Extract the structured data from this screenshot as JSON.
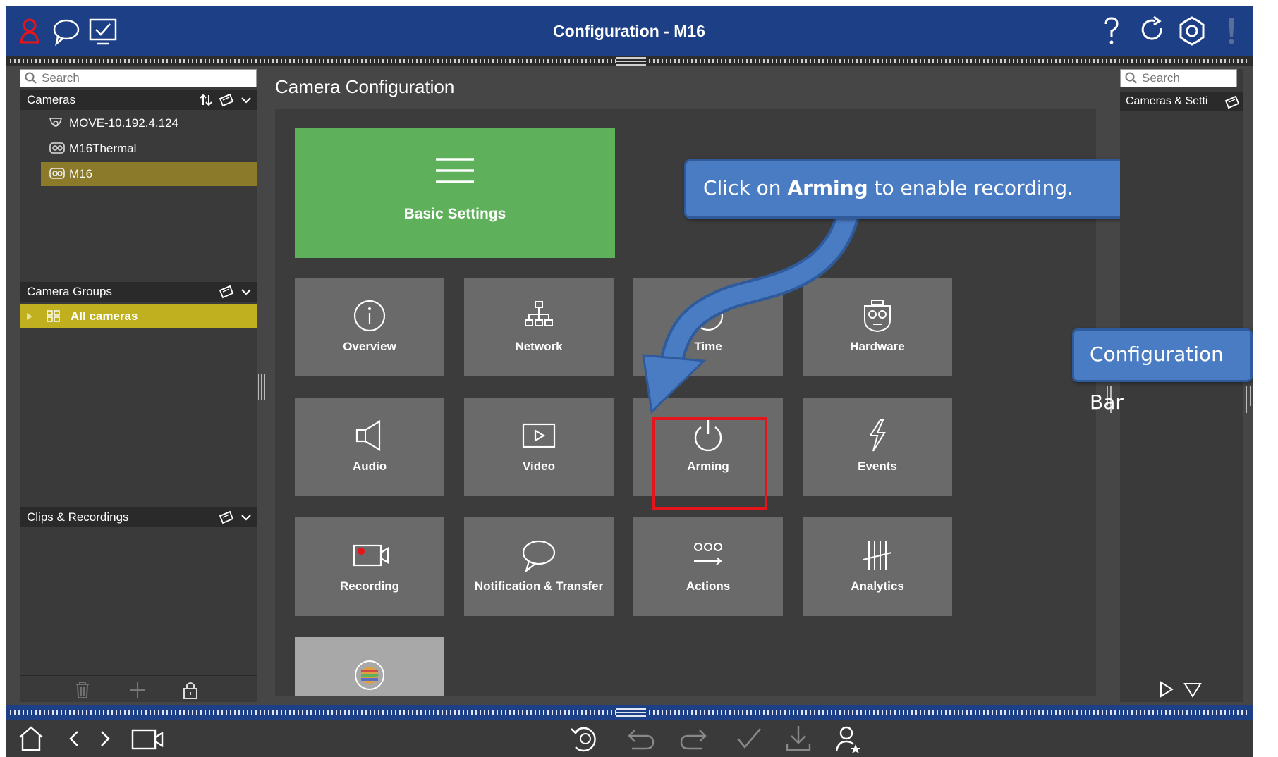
{
  "window": {
    "title": "Configuration - M16"
  },
  "left_panel": {
    "search_placeholder": "Search",
    "cameras_header": "Cameras",
    "cameras": [
      {
        "name": "MOVE-10.192.4.124",
        "selected": false
      },
      {
        "name": "M16Thermal",
        "selected": false
      },
      {
        "name": "M16",
        "selected": true
      }
    ],
    "groups_header": "Camera Groups",
    "group_selected": "All cameras",
    "clips_header": "Clips & Recordings"
  },
  "main": {
    "heading": "Camera Configuration",
    "basic_settings_label": "Basic Settings",
    "tiles": [
      {
        "label": "Overview",
        "icon": "info-icon"
      },
      {
        "label": "Network",
        "icon": "network-icon"
      },
      {
        "label": "Time",
        "icon": "clock-icon"
      },
      {
        "label": "Hardware",
        "icon": "hardware-icon"
      },
      {
        "label": "Audio",
        "icon": "speaker-icon"
      },
      {
        "label": "Video",
        "icon": "video-play-icon"
      },
      {
        "label": "Arming",
        "icon": "power-icon"
      },
      {
        "label": "Events",
        "icon": "lightning-icon"
      },
      {
        "label": "Recording",
        "icon": "recording-camera-icon"
      },
      {
        "label": "Notification & Transfer",
        "icon": "speech-bubble-icon"
      },
      {
        "label": "Actions",
        "icon": "actions-icon"
      },
      {
        "label": "Analytics",
        "icon": "tally-icon"
      }
    ]
  },
  "right_panel": {
    "search_placeholder": "Search",
    "section_label": "Cameras & Setti"
  },
  "annotations": {
    "arming_callout_prefix": "Click on ",
    "arming_callout_bold": "Arming",
    "arming_callout_suffix": " to enable recording.",
    "config_bar_callout": "Configuration Bar"
  },
  "colors": {
    "titlebar": "#1c3f86",
    "basic_settings": "#5fb05b",
    "selected_camera": "#8a7a2a",
    "selected_group": "#c0b020",
    "highlight": "#e8141b",
    "callout": "#4a7cc4"
  }
}
